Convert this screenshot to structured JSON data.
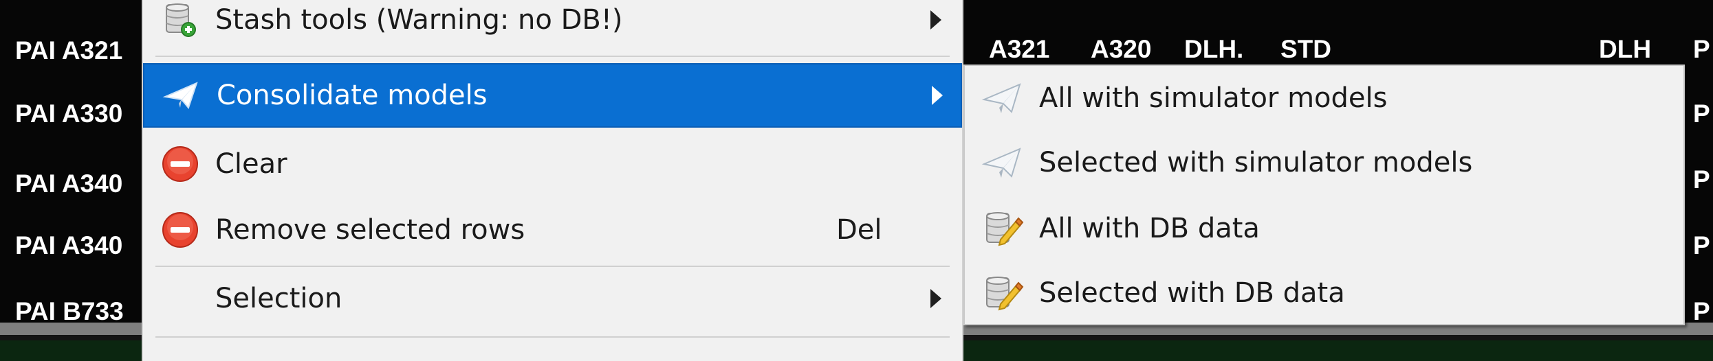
{
  "table": {
    "rows_left": [
      "PAI A321",
      "PAI A330",
      "PAI A340",
      "PAI A340",
      "PAI B733"
    ],
    "header_cells": [
      "A321",
      "A320",
      "DLH.",
      "STD",
      "DLH",
      "P"
    ],
    "rows_right": [
      "P",
      "P",
      "P",
      "P"
    ]
  },
  "context_menu": {
    "items": [
      {
        "label": "Stash tools (Warning: no DB!)",
        "icon": "database-add-icon",
        "submenu": true
      },
      {
        "label": "Consolidate models",
        "icon": "paper-plane-icon",
        "submenu": true,
        "highlighted": true
      },
      {
        "label": "Clear",
        "icon": "remove-icon"
      },
      {
        "label": "Remove selected rows",
        "icon": "remove-icon",
        "shortcut": "Del"
      },
      {
        "label": "Selection",
        "submenu": true
      }
    ]
  },
  "submenu": {
    "items": [
      {
        "label": "All with simulator models",
        "icon": "paper-plane-icon"
      },
      {
        "label": "Selected with simulator models",
        "icon": "paper-plane-icon"
      },
      {
        "label": "All with DB data",
        "icon": "database-edit-icon"
      },
      {
        "label": "Selected with DB data",
        "icon": "database-edit-icon"
      }
    ]
  },
  "colors": {
    "highlight": "#0a6fd2",
    "menu_background": "#f1f1f1",
    "remove_icon": "#e8432f"
  }
}
